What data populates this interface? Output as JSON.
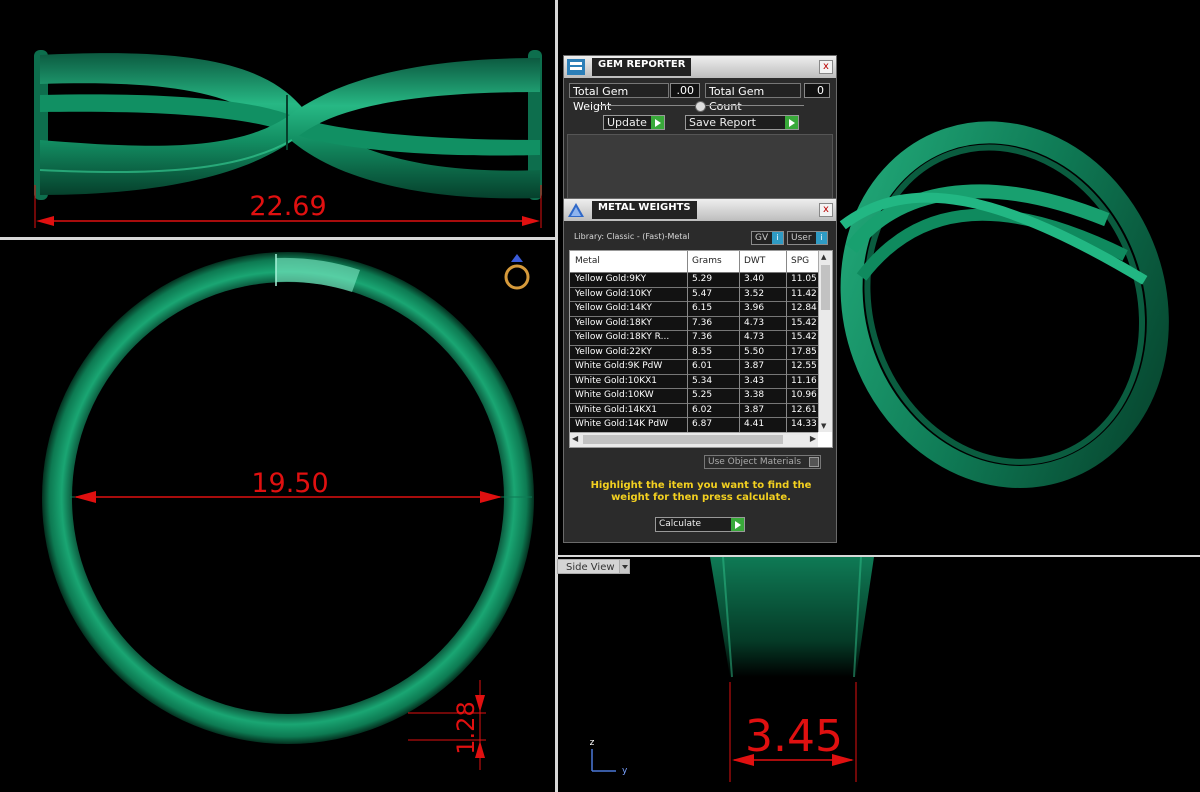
{
  "viewports": {
    "top_dimension": "22.69",
    "front_dimension": "19.50",
    "thickness_dimension": "1.28",
    "side_dimension": "3.45",
    "side_view_label": "Side View",
    "axis_z": "z",
    "axis_y": "y"
  },
  "gem_reporter": {
    "title": "GEM REPORTER",
    "total_weight_label": "Total Gem Weight",
    "total_weight_value": ".00",
    "total_count_label": "Total Gem Count",
    "total_count_value": "0",
    "update_label": "Update",
    "save_report_label": "Save Report",
    "close": "x"
  },
  "metal_weights": {
    "title": "METAL WEIGHTS",
    "library": "Library: Classic - (Fast)-Metal",
    "gv_label": "GV",
    "user_label": "User",
    "columns": [
      "Metal",
      "Grams",
      "DWT",
      "SPG"
    ],
    "rows": [
      [
        "Yellow Gold:9KY",
        "5.29",
        "3.40",
        "11.05"
      ],
      [
        "Yellow Gold:10KY",
        "5.47",
        "3.52",
        "11.42"
      ],
      [
        "Yellow Gold:14KY",
        "6.15",
        "3.96",
        "12.84"
      ],
      [
        "Yellow Gold:18KY",
        "7.36",
        "4.73",
        "15.42"
      ],
      [
        "Yellow Gold:18KY R...",
        "7.36",
        "4.73",
        "15.42"
      ],
      [
        "Yellow Gold:22KY",
        "8.55",
        "5.50",
        "17.85"
      ],
      [
        "White Gold:9K PdW",
        "6.01",
        "3.87",
        "12.55"
      ],
      [
        "White Gold:10KX1",
        "5.34",
        "3.43",
        "11.16"
      ],
      [
        "White Gold:10KW",
        "5.25",
        "3.38",
        "10.96"
      ],
      [
        "White Gold:14KX1",
        "6.02",
        "3.87",
        "12.61"
      ],
      [
        "White Gold:14K PdW",
        "6.87",
        "4.41",
        "14.33"
      ]
    ],
    "use_object_materials": "Use Object Materials",
    "hint": "Highlight the item you want to find the weight for then press calculate.",
    "calculate_label": "Calculate",
    "close": "x"
  },
  "colors": {
    "ring_green": "#0f7a55",
    "dimension_red": "#e01010",
    "hint_yellow": "#f3d020"
  }
}
